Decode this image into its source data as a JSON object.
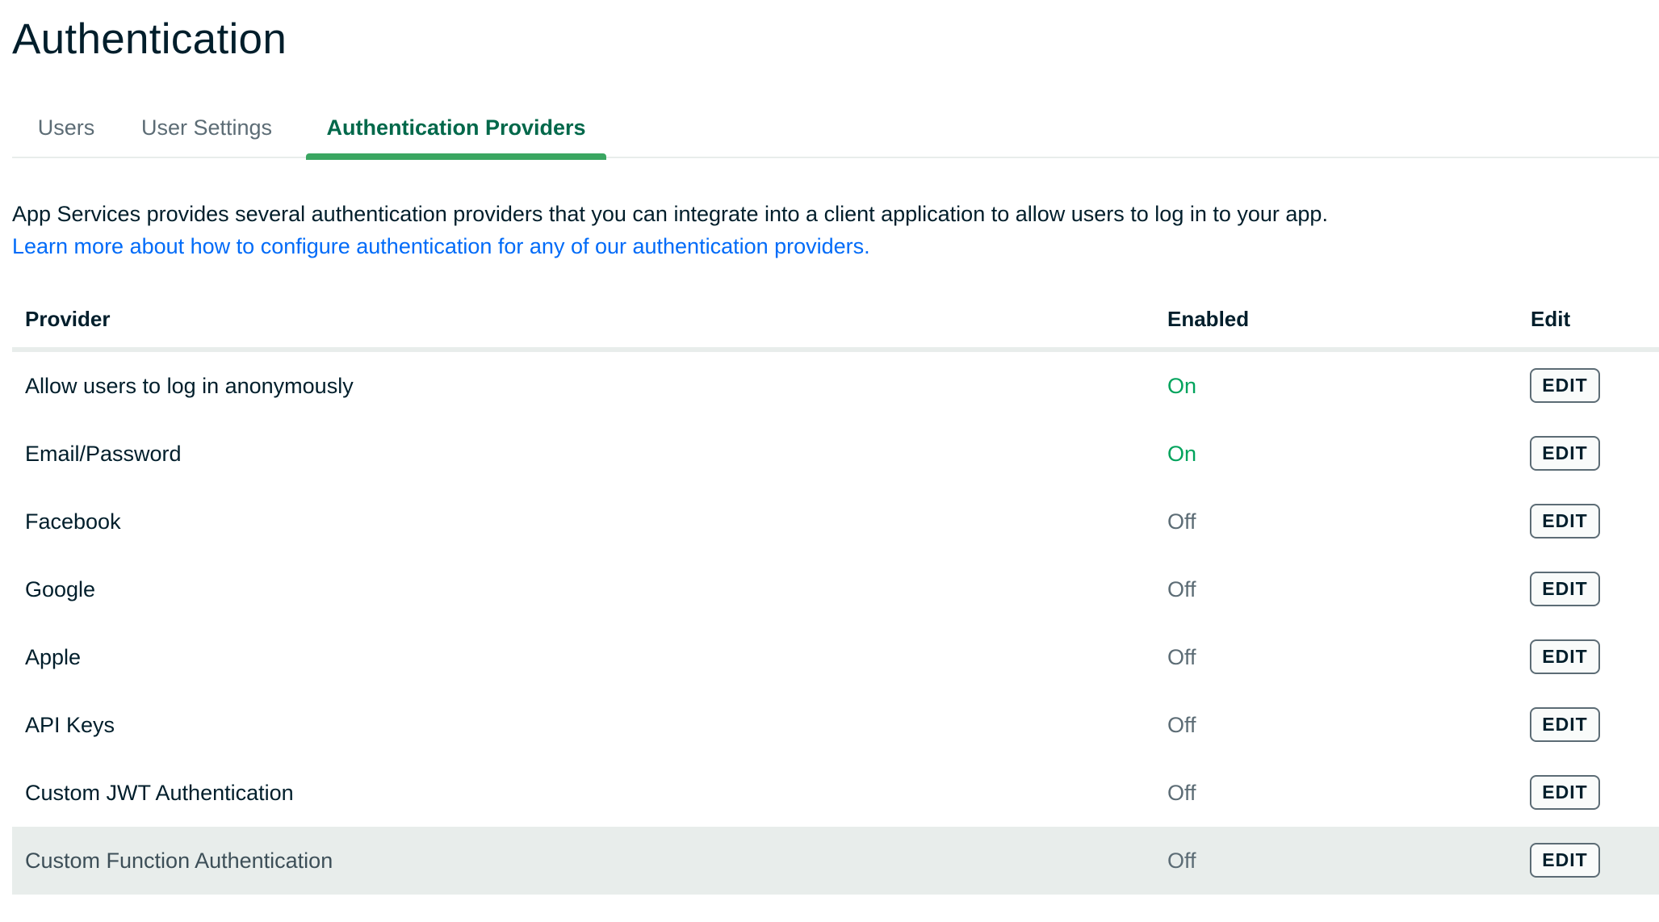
{
  "page": {
    "title": "Authentication"
  },
  "tabs": [
    {
      "label": "Users",
      "active": false
    },
    {
      "label": "User Settings",
      "active": false
    },
    {
      "label": "Authentication Providers",
      "active": true
    }
  ],
  "intro": {
    "text": "App Services provides several authentication providers that you can integrate into a client application to allow users to log in to your app.",
    "link_text": "Learn more about how to configure authentication for any of our authentication providers."
  },
  "table": {
    "headers": {
      "provider": "Provider",
      "enabled": "Enabled",
      "edit": "Edit"
    },
    "rows": [
      {
        "provider": "Allow users to log in anonymously",
        "enabled": "On",
        "edit": "EDIT"
      },
      {
        "provider": "Email/Password",
        "enabled": "On",
        "edit": "EDIT"
      },
      {
        "provider": "Facebook",
        "enabled": "Off",
        "edit": "EDIT"
      },
      {
        "provider": "Google",
        "enabled": "Off",
        "edit": "EDIT"
      },
      {
        "provider": "Apple",
        "enabled": "Off",
        "edit": "EDIT"
      },
      {
        "provider": "API Keys",
        "enabled": "Off",
        "edit": "EDIT"
      },
      {
        "provider": "Custom JWT Authentication",
        "enabled": "Off",
        "edit": "EDIT"
      },
      {
        "provider": "Custom Function Authentication",
        "enabled": "Off",
        "edit": "EDIT"
      }
    ]
  },
  "colors": {
    "active_tab": "#00684a",
    "tab_indicator": "#3aa661",
    "status_on": "#00a35c",
    "status_off": "#5c6c75",
    "link": "#016bf8",
    "row_hover_bg": "#e8edeb"
  }
}
